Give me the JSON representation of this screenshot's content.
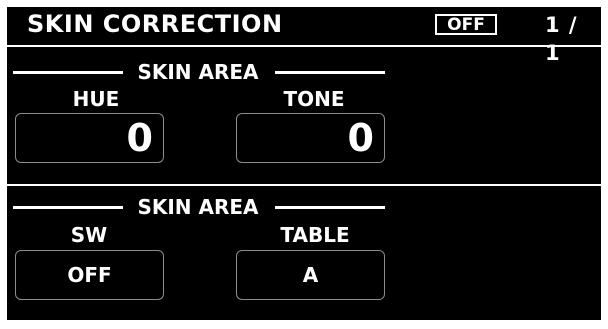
{
  "header": {
    "title": "SKIN CORRECTION",
    "status": "OFF",
    "page": "1 / 1"
  },
  "sections": [
    {
      "heading": "SKIN AREA",
      "fields": [
        {
          "label": "HUE",
          "value": "0"
        },
        {
          "label": "TONE",
          "value": "0"
        }
      ]
    },
    {
      "heading": "SKIN AREA",
      "fields": [
        {
          "label": "SW",
          "value": "OFF"
        },
        {
          "label": "TABLE",
          "value": "A"
        }
      ]
    }
  ]
}
